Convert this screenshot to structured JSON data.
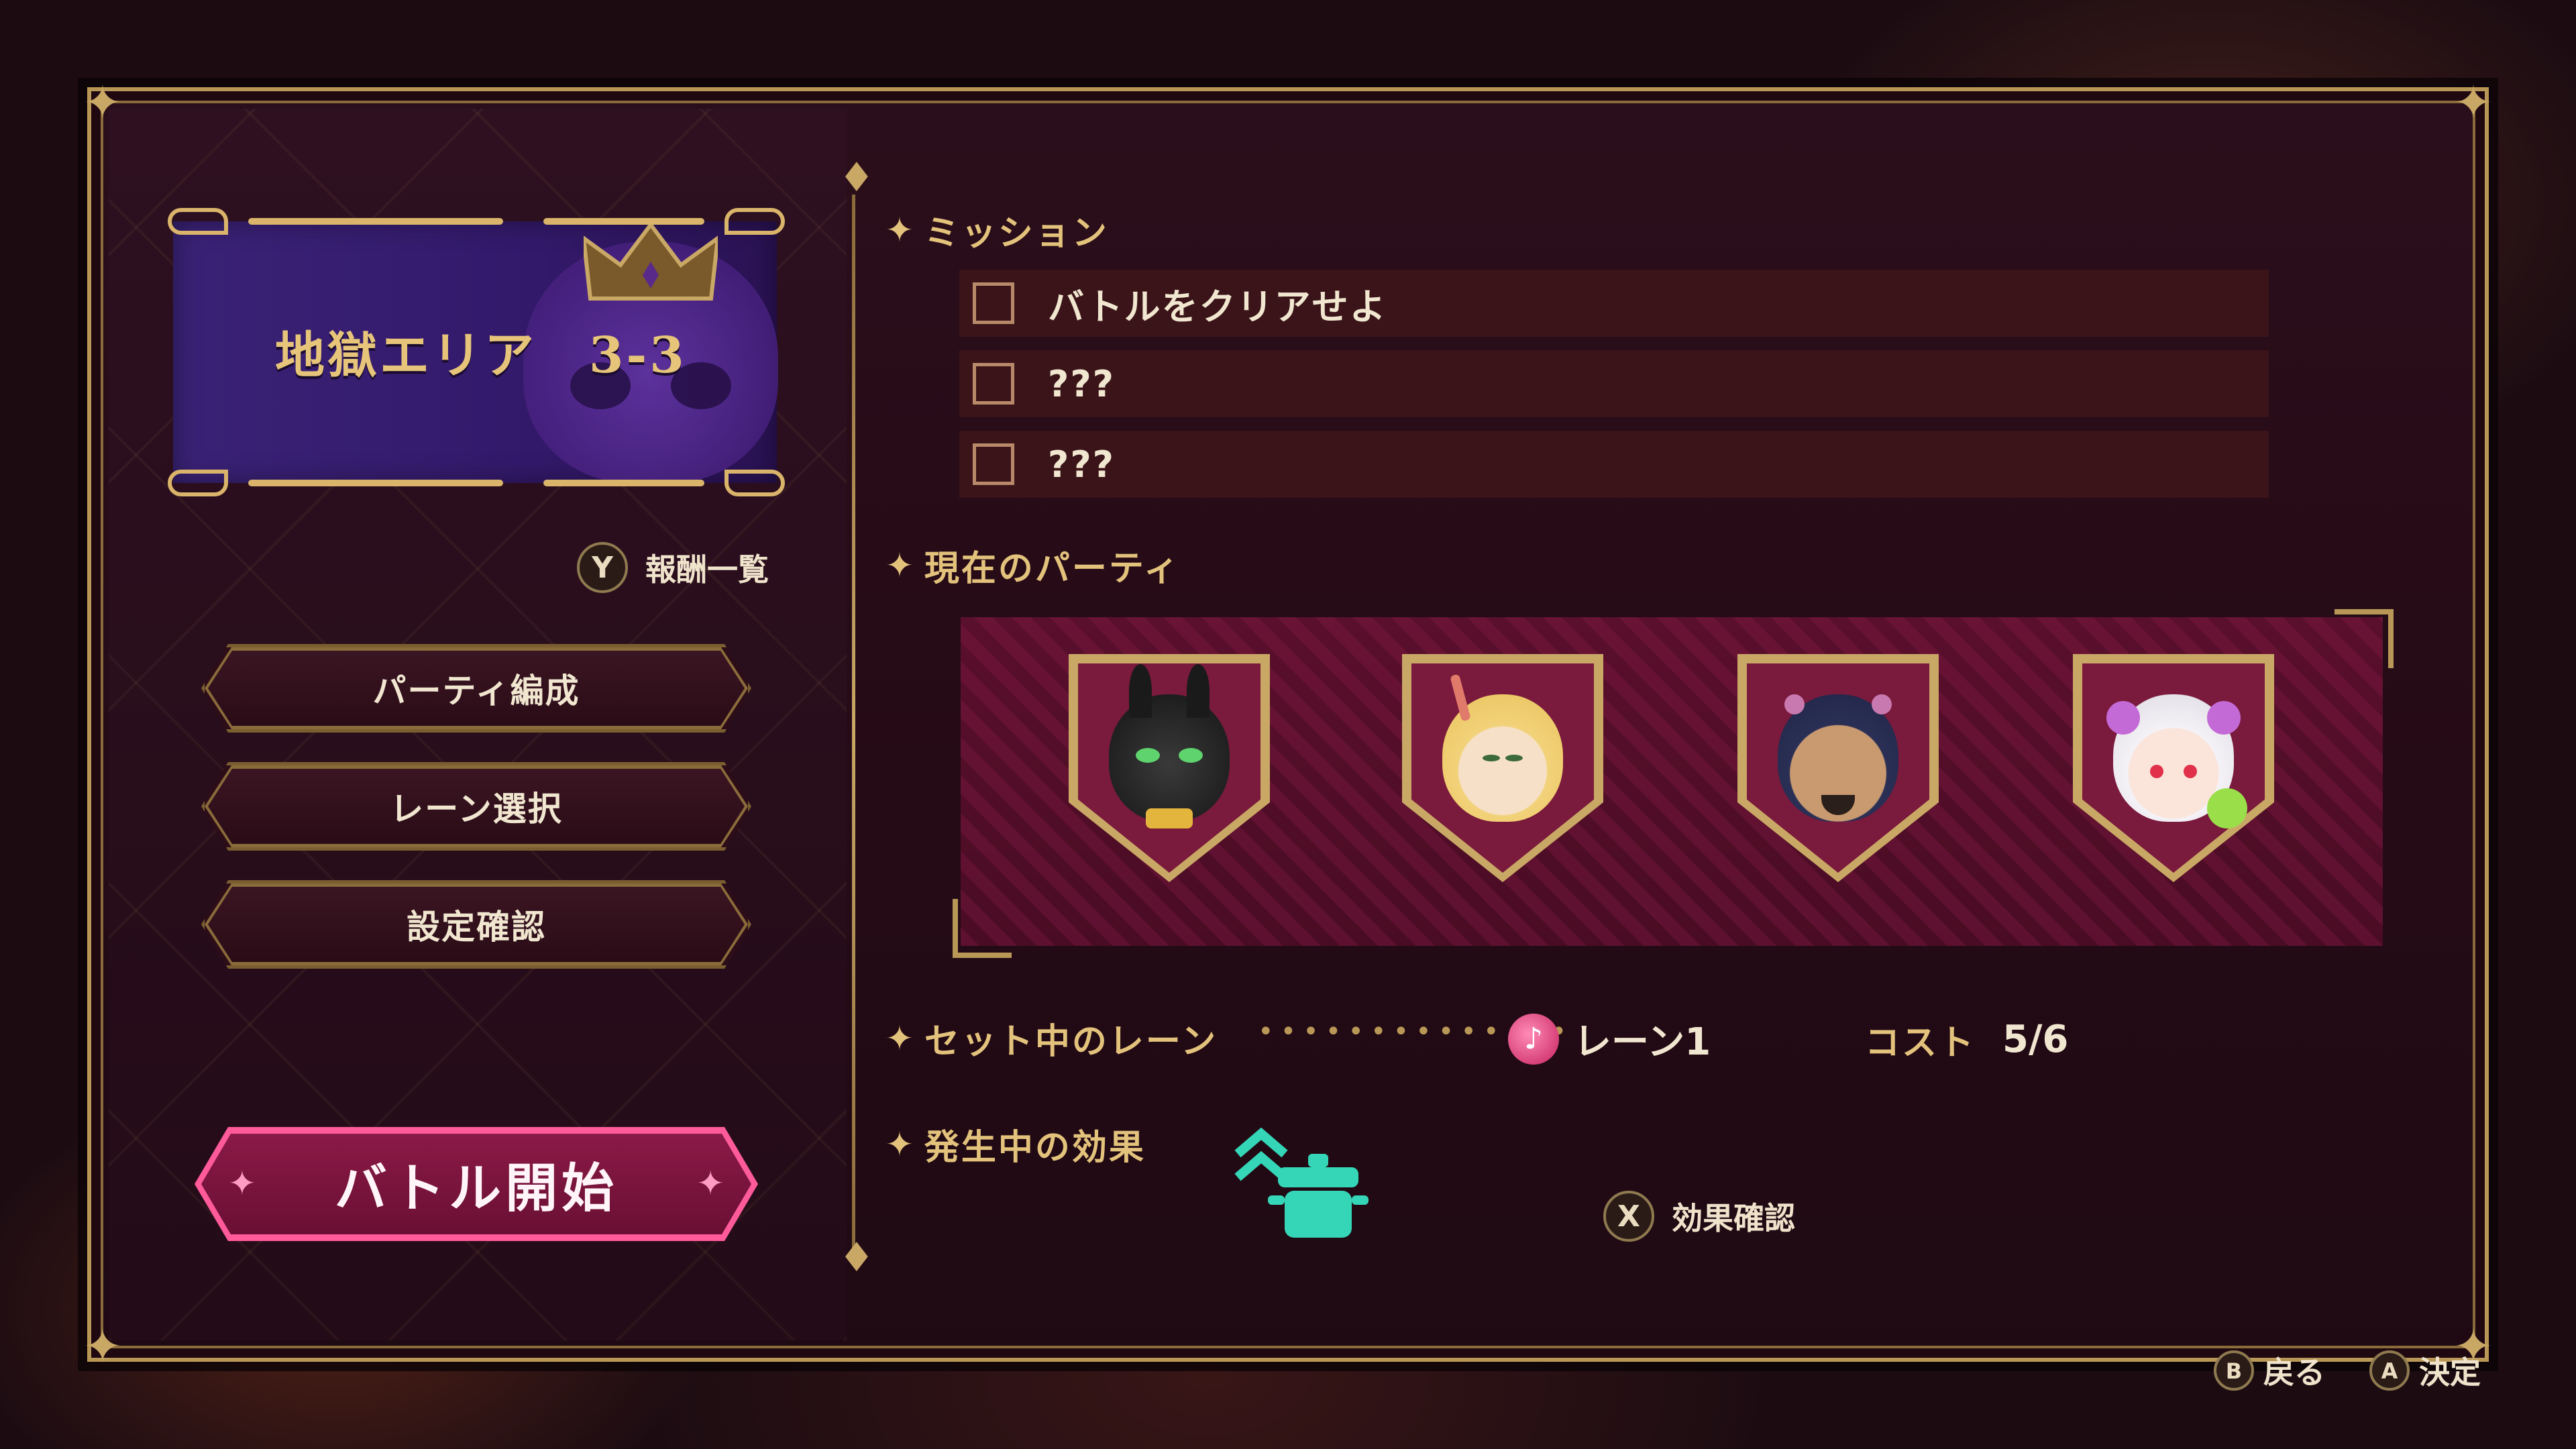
{
  "area": {
    "title": "地獄エリア　3-3"
  },
  "rewards": {
    "button_glyph": "Y",
    "label": "報酬一覧"
  },
  "menu": [
    {
      "label": "パーティ編成"
    },
    {
      "label": "レーン選択"
    },
    {
      "label": "設定確認"
    }
  ],
  "battle_start": {
    "label": "バトル開始"
  },
  "mission": {
    "title": "ミッション",
    "items": [
      {
        "text": "バトルをクリアせよ",
        "checked": false
      },
      {
        "text": "???",
        "checked": false
      },
      {
        "text": "???",
        "checked": false
      }
    ]
  },
  "party": {
    "title": "現在のパーティ",
    "members": [
      {
        "icon": "black-cat-character-portrait"
      },
      {
        "icon": "blonde-horned-character-portrait"
      },
      {
        "icon": "bearded-demon-character-portrait"
      },
      {
        "icon": "white-haired-girl-character-portrait"
      }
    ]
  },
  "lane": {
    "title": "セット中のレーン",
    "value": "レーン1",
    "cost_label": "コスト",
    "cost_value": "5/6",
    "icon": "music-note-icon"
  },
  "effects": {
    "title": "発生中の効果",
    "icons": [
      "rank-up-chevron-icon",
      "cooking-pot-icon"
    ],
    "button_glyph": "X",
    "confirm_label": "効果確認"
  },
  "footer": {
    "back_glyph": "B",
    "back_label": "戻る",
    "confirm_glyph": "A",
    "confirm_label": "決定"
  },
  "colors": {
    "gold": "#e3c27c",
    "frame": "#b99756",
    "accent_pink": "#ff5a9a",
    "panel": "#5a0f2c"
  }
}
